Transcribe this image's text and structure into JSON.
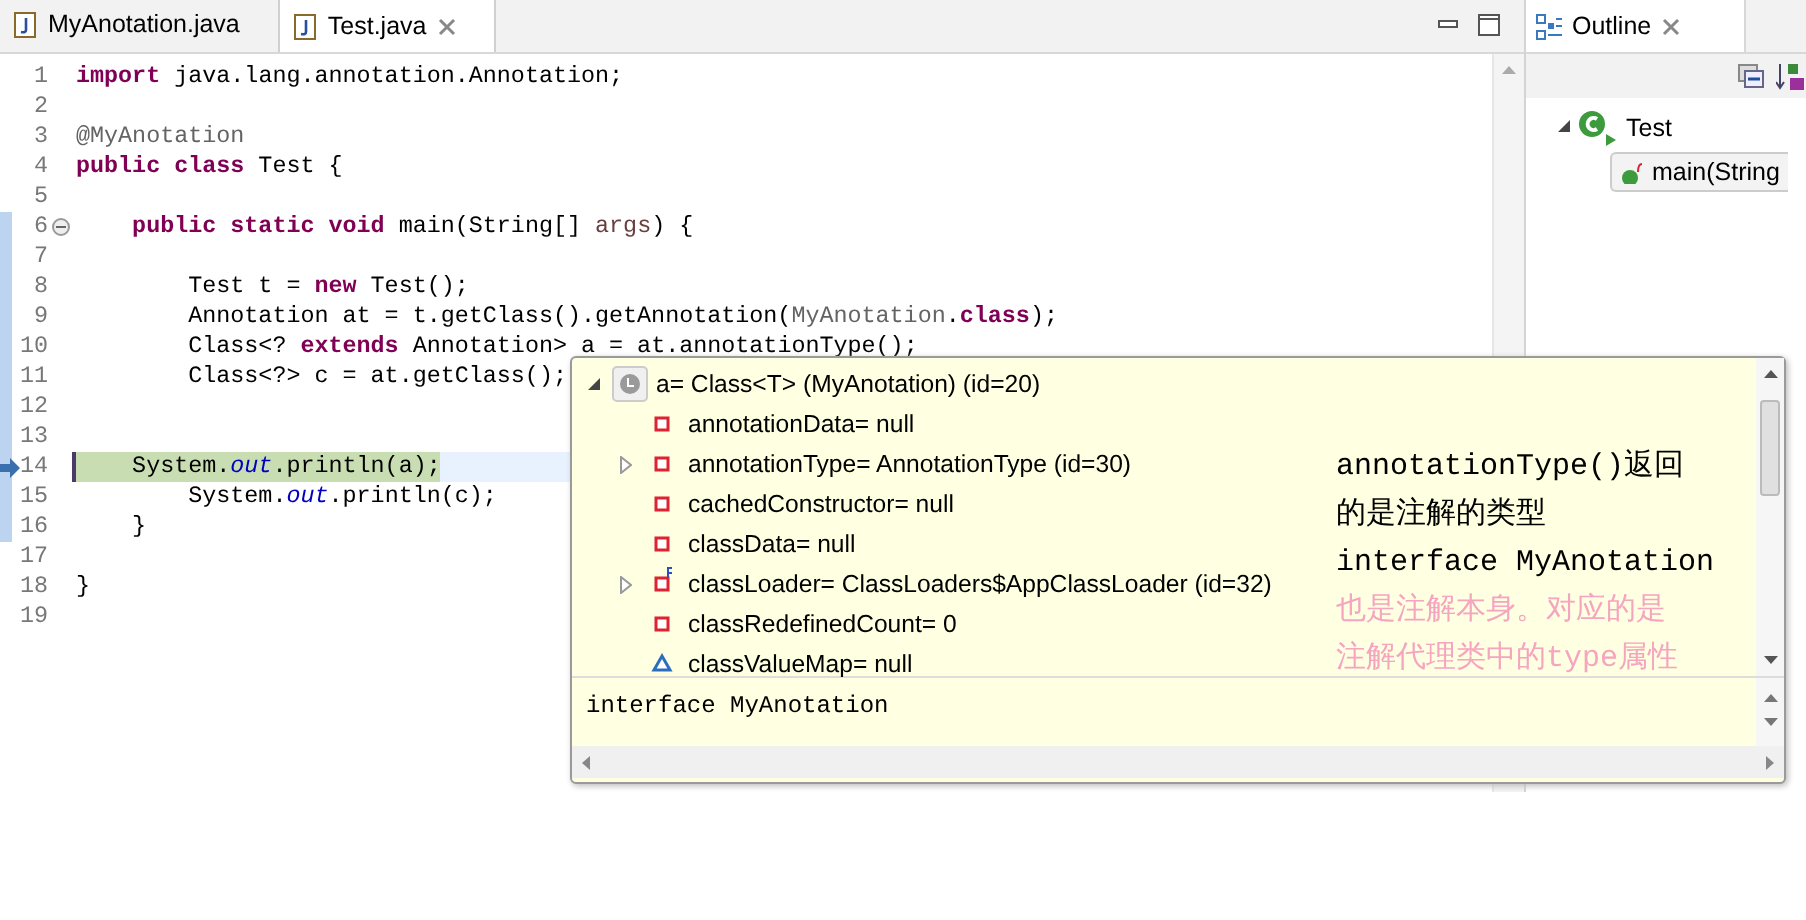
{
  "editor": {
    "tabs": [
      {
        "label": "MyAnotation.java",
        "selected": false
      },
      {
        "label": "Test.java",
        "selected": true
      }
    ],
    "lines": [
      {
        "number": "1",
        "segments": [
          {
            "kind": "keyword",
            "text": "import"
          },
          {
            "kind": "plain",
            "text": " java.lang.annotation.Annotation;"
          }
        ]
      },
      {
        "number": "2"
      },
      {
        "number": "3",
        "segments": [
          {
            "kind": "annotation",
            "text": "@MyAnotation"
          }
        ]
      },
      {
        "number": "4",
        "segments": [
          {
            "kind": "keyword",
            "text": "public class"
          },
          {
            "kind": "plain",
            "text": " Test {"
          }
        ]
      },
      {
        "number": "5"
      },
      {
        "number": "6",
        "fold": true,
        "segments": [
          {
            "kind": "keyword",
            "text": "    public static void"
          },
          {
            "kind": "plain",
            "text": " main(String[] "
          },
          {
            "kind": "param",
            "text": "args"
          },
          {
            "kind": "plain",
            "text": ") {"
          }
        ]
      },
      {
        "number": "7"
      },
      {
        "number": "8",
        "segments": [
          {
            "kind": "plain",
            "text": "        Test t = "
          },
          {
            "kind": "keyword",
            "text": "new"
          },
          {
            "kind": "plain",
            "text": " Test();"
          }
        ]
      },
      {
        "number": "9",
        "segments": [
          {
            "kind": "plain",
            "text": "        Annotation at = t.getClass().getAnnotation("
          },
          {
            "kind": "annotation",
            "text": "MyAnotation"
          },
          {
            "kind": "plain",
            "text": "."
          },
          {
            "kind": "keyword",
            "text": "class"
          },
          {
            "kind": "plain",
            "text": ");"
          }
        ]
      },
      {
        "number": "10",
        "segments": [
          {
            "kind": "plain",
            "text": "        Class<? "
          },
          {
            "kind": "keyword",
            "text": "extends"
          },
          {
            "kind": "plain",
            "text": " Annotation> a = at.annotationType();"
          }
        ]
      },
      {
        "number": "11",
        "segments": [
          {
            "kind": "plain",
            "text": "        Class<?> c = at.getClass();"
          }
        ]
      },
      {
        "number": "12"
      },
      {
        "number": "13"
      },
      {
        "number": "14",
        "current": true,
        "segments": [
          {
            "kind": "plain",
            "text": "    System."
          },
          {
            "kind": "static",
            "text": "out"
          },
          {
            "kind": "plain",
            "text": ".println(a);"
          }
        ]
      },
      {
        "number": "15",
        "segments": [
          {
            "kind": "plain",
            "text": "        System."
          },
          {
            "kind": "static",
            "text": "out"
          },
          {
            "kind": "plain",
            "text": ".println(c);"
          }
        ]
      },
      {
        "number": "16",
        "segments": [
          {
            "kind": "plain",
            "text": "    }"
          }
        ]
      },
      {
        "number": "17"
      },
      {
        "number": "18",
        "segments": [
          {
            "kind": "plain",
            "text": "}"
          }
        ]
      },
      {
        "number": "19"
      }
    ]
  },
  "inspect_popup": {
    "tree": [
      {
        "text": "a= Class<T> (MyAnotation) (id=20)",
        "kind": "local",
        "expanded": true,
        "children": [
          {
            "text": "annotationData= null",
            "kind": "field"
          },
          {
            "text": "annotationType= AnnotationType  (id=30)",
            "kind": "field",
            "expanded": false
          },
          {
            "text": "cachedConstructor= null",
            "kind": "field"
          },
          {
            "text": "classData= null",
            "kind": "field"
          },
          {
            "text": "classLoader= ClassLoaders$AppClassLoader  (id=32)",
            "kind": "final-field",
            "expanded": false
          },
          {
            "text": "classRedefinedCount= 0",
            "kind": "field"
          },
          {
            "text": "classValueMap= null",
            "kind": "package-field"
          }
        ]
      }
    ],
    "detail": "interface MyAnotation"
  },
  "note": {
    "lines": [
      {
        "text": "annotationType()返回",
        "color": "#000000"
      },
      {
        "text": "的是注解的类型",
        "color": "#000000"
      },
      {
        "text": "interface MyAnotation",
        "color": "#000000"
      },
      {
        "text": "也是注解本身。对应的是",
        "color": "#f6a5c0"
      },
      {
        "text": "注解代理类中的type属性",
        "color": "#f6a5c0"
      }
    ]
  },
  "outline": {
    "title": "Outline",
    "tree": [
      {
        "label": "Test",
        "expanded": true,
        "children": [
          {
            "label": "main(String",
            "selected": true
          }
        ]
      }
    ]
  }
}
